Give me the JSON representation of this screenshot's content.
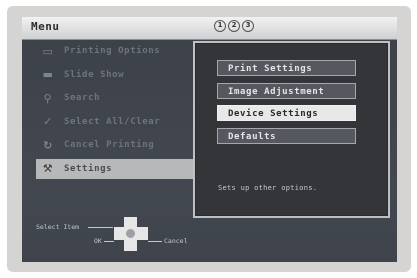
{
  "header": {
    "title": "Menu",
    "status_icons": [
      "mode-1-icon",
      "mode-2-icon",
      "mode-3-icon"
    ]
  },
  "left_menu": {
    "items": [
      {
        "label": "Printing Options",
        "icon": "printer-icon"
      },
      {
        "label": "Slide Show",
        "icon": "film-icon"
      },
      {
        "label": "Search",
        "icon": "search-icon"
      },
      {
        "label": "Select All/Clear",
        "icon": "checkmark-icon"
      },
      {
        "label": "Cancel Printing",
        "icon": "cancel-print-icon"
      },
      {
        "label": "Settings",
        "icon": "wrench-icon",
        "active": true
      }
    ]
  },
  "submenu": {
    "items": [
      {
        "label": "Print Settings"
      },
      {
        "label": "Image Adjustment"
      },
      {
        "label": "Device Settings",
        "selected": true
      },
      {
        "label": "Defaults"
      }
    ],
    "help_text": "Sets up other options."
  },
  "footer": {
    "select_item_label": "Select Item",
    "ok_label": "OK",
    "cancel_label": "Cancel"
  },
  "colors": {
    "screen_bg": "#3f444c",
    "panel_bg": "#333539",
    "highlight": "#e8e8e8",
    "button_bg": "#55585e"
  }
}
